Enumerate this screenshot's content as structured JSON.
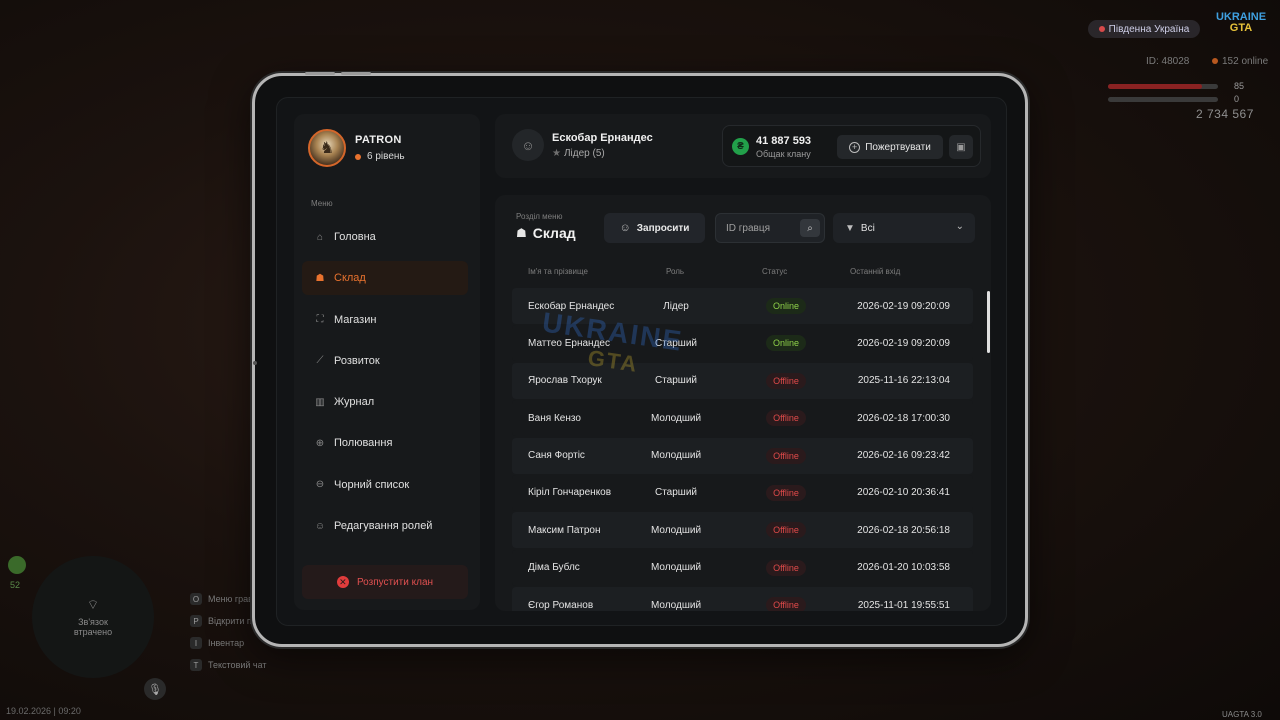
{
  "hud": {
    "server": "Південна Україна",
    "logo_top": "UKRAINE",
    "logo_bottom": "GTA",
    "player_id": "ID: 48028",
    "online": "152 online",
    "health": "85",
    "armor": "0",
    "money": "2 734 567",
    "hunger": "52",
    "map_status": "Зв'язок втрачено",
    "hints": [
      {
        "key": "O",
        "label": "Меню гравця"
      },
      {
        "key": "P",
        "label": "Відкрити пл."
      },
      {
        "key": "I",
        "label": "Інвентар"
      },
      {
        "key": "T",
        "label": "Текстовий чат"
      }
    ],
    "datetime": "19.02.2026 | 09:20",
    "version": "UAGTA 3.0"
  },
  "profile": {
    "name": "PATRON",
    "level": "6 рівень"
  },
  "sidebar": {
    "menu_label": "Меню",
    "items": [
      {
        "label": "Головна",
        "icon": "home-icon",
        "glyph": "⌂"
      },
      {
        "label": "Склад",
        "icon": "members-icon",
        "glyph": "☗"
      },
      {
        "label": "Магазин",
        "icon": "shop-icon",
        "glyph": "⛶"
      },
      {
        "label": "Розвиток",
        "icon": "chart-icon",
        "glyph": "⟋"
      },
      {
        "label": "Журнал",
        "icon": "book-icon",
        "glyph": "▥"
      },
      {
        "label": "Полювання",
        "icon": "crosshair-icon",
        "glyph": "⊕"
      },
      {
        "label": "Чорний список",
        "icon": "block-icon",
        "glyph": "⊖"
      },
      {
        "label": "Редагування ролей",
        "icon": "user-edit-icon",
        "glyph": "☺"
      }
    ],
    "disband_label": "Розпустити клан"
  },
  "header": {
    "leader_name": "Ескобар Ернандес",
    "leader_role": "Лідер (5)",
    "bank_amount": "41 887 593",
    "bank_label": "Общак клану",
    "donate_label": "Пожертвувати"
  },
  "section": {
    "subtitle": "Розділ меню",
    "title": "Склад",
    "invite_label": "Запросити",
    "search_placeholder": "ID гравця",
    "filter_value": "Всі"
  },
  "table": {
    "columns": [
      "Ім'я та прізвище",
      "Роль",
      "Статус",
      "Останній вхід"
    ],
    "rows": [
      {
        "name": "Ескобар Ернандес",
        "role": "Лідер",
        "status": "Online",
        "last_login": "2026-02-19 09:20:09"
      },
      {
        "name": "Маттео Ернандес",
        "role": "Старший",
        "status": "Online",
        "last_login": "2026-02-19 09:20:09"
      },
      {
        "name": "Ярослав Тхорук",
        "role": "Старший",
        "status": "Offline",
        "last_login": "2025-11-16 22:13:04"
      },
      {
        "name": "Ваня Кензо",
        "role": "Молодший",
        "status": "Offline",
        "last_login": "2026-02-18 17:00:30"
      },
      {
        "name": "Саня Фортіс",
        "role": "Молодший",
        "status": "Offline",
        "last_login": "2026-02-16 09:23:42"
      },
      {
        "name": "Кіріл Гончаренков",
        "role": "Старший",
        "status": "Offline",
        "last_login": "2026-02-10 20:36:41"
      },
      {
        "name": "Максим Патрон",
        "role": "Молодший",
        "status": "Offline",
        "last_login": "2026-02-18 20:56:18"
      },
      {
        "name": "Діма Бублс",
        "role": "Молодший",
        "status": "Offline",
        "last_login": "2026-01-20 10:03:58"
      },
      {
        "name": "Єгор Романов",
        "role": "Молодший",
        "status": "Offline",
        "last_login": "2025-11-01 19:55:51"
      }
    ]
  },
  "watermark": {
    "top": "UKRAINE",
    "bottom": "GTA"
  },
  "colors": {
    "accent": "#e8722e",
    "online": "#8fd24a",
    "offline": "#e04a4a",
    "bank_coin": "#22a04a"
  }
}
